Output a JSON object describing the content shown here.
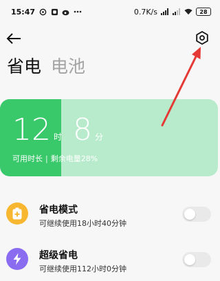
{
  "status_bar": {
    "time": "15:47",
    "net_speed": "0.7K/s",
    "battery_level": "28"
  },
  "header": {
    "tabs": [
      {
        "label": "省电",
        "active": true
      },
      {
        "label": "电池",
        "active": false
      }
    ]
  },
  "battery_card": {
    "hours": "12",
    "hours_unit": "时",
    "minutes": "8",
    "minutes_unit": "分",
    "usable_label": "可用时长",
    "separator": "|",
    "remaining_label": "剩余电量28%",
    "remaining_fraction": 0.28,
    "fill_color": "#39c86a",
    "track_color": "#b7ebcb"
  },
  "modes": [
    {
      "title": "省电模式",
      "subtitle": "可继续使用18小时40分钟",
      "icon": "battery-plus-icon",
      "icon_color": "#f7b731",
      "enabled": false
    },
    {
      "title": "超级省电",
      "subtitle": "可继续使用112小时0分钟",
      "icon": "lightning-icon",
      "icon_color": "#8a6cf0",
      "enabled": false
    }
  ],
  "annotation_color": "#e53935"
}
